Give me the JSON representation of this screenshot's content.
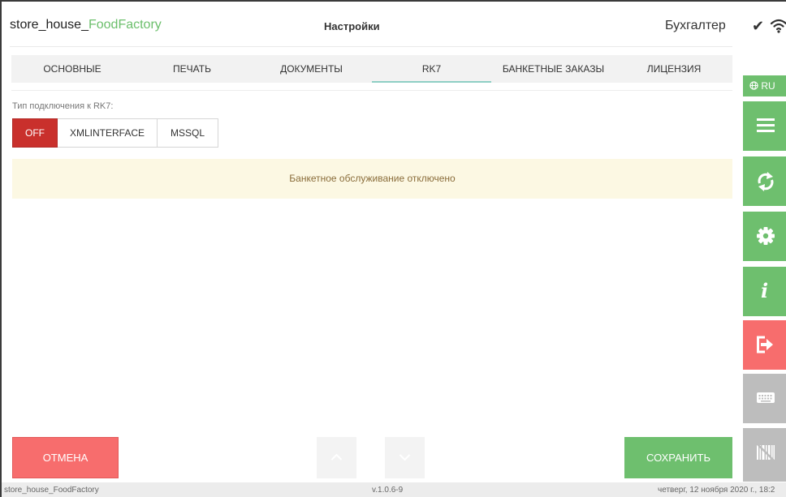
{
  "header": {
    "app_name_prefix": "store_house_",
    "app_name_suffix": "FoodFactory",
    "screen_title": "Настройки",
    "user_role": "Бухгалтер"
  },
  "tabs": [
    {
      "label": "ОСНОВНЫЕ",
      "active": false
    },
    {
      "label": "ПЕЧАТЬ",
      "active": false
    },
    {
      "label": "ДОКУМЕНТЫ",
      "active": false
    },
    {
      "label": "RK7",
      "active": true
    },
    {
      "label": "БАНКЕТНЫЕ ЗАКАЗЫ",
      "active": false
    },
    {
      "label": "ЛИЦЕНЗИЯ",
      "active": false
    }
  ],
  "connection": {
    "label": "Тип подключения к RK7:",
    "options": [
      "OFF",
      "XMLINTERFACE",
      "MSSQL"
    ],
    "selected": "OFF"
  },
  "notice": {
    "text": "Банкетное обслуживание отключено"
  },
  "actions": {
    "cancel_label": "ОТМЕНА",
    "save_label": "СОХРАНИТЬ"
  },
  "statusbar": {
    "app": "store_house_FoodFactory",
    "version": "v.1.0.6-9",
    "datetime": "четверг, 12 ноября 2020 г., 18:2"
  },
  "rail": {
    "language": "RU",
    "buttons": [
      "menu-icon",
      "sync-icon",
      "gear-icon",
      "info-icon",
      "logout-icon",
      "keyboard-icon",
      "barcode-icon"
    ]
  },
  "colors": {
    "green": "#6ebf6e",
    "red": "#f76d6d",
    "danger": "#c9302c",
    "notice_bg": "#fcf8e3",
    "notice_text": "#8a6d3b",
    "tab_underline": "#8fcfc4"
  }
}
